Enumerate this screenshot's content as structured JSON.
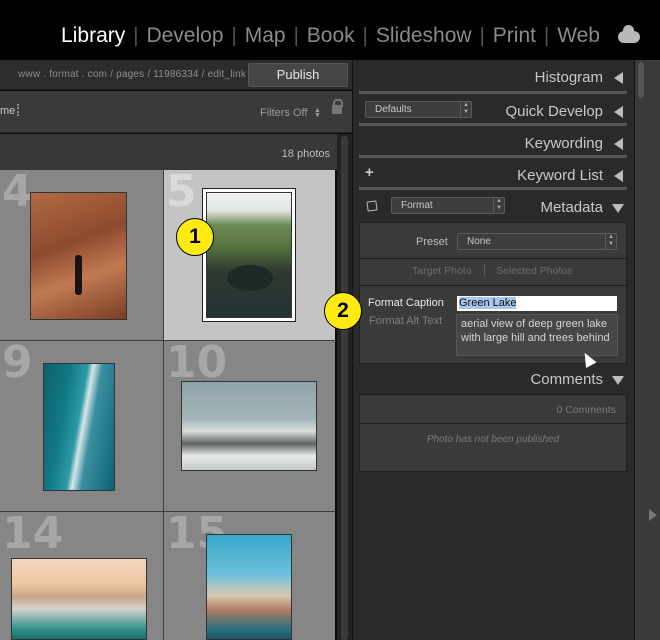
{
  "modules": [
    "Library",
    "Develop",
    "Map",
    "Book",
    "Slideshow",
    "Print",
    "Web"
  ],
  "active_module": "Library",
  "toolbar": {
    "url": "www . format . com / pages / 11986334 / edit_link",
    "publish_label": "Publish",
    "partial_label": "me",
    "filters_label": "Filters Off",
    "photo_count": "18 photos"
  },
  "grid": {
    "cells": [
      "4",
      "5",
      "9",
      "10",
      "14",
      "15"
    ],
    "selected": "5"
  },
  "panel": {
    "histogram": "Histogram",
    "quick_develop": "Quick Develop",
    "quick_develop_preset": "Defaults",
    "keywording": "Keywording",
    "keyword_list": "Keyword List",
    "metadata": "Metadata",
    "metadata_set": "Format",
    "preset_label": "Preset",
    "preset_value": "None",
    "target_photo": "Target Photo",
    "selected_photos": "Selected Photos",
    "format_caption_label": "Format Caption",
    "format_caption_value": "Green Lake",
    "format_alt_label": "Format Alt Text",
    "format_alt_value": "aerial view of deep green lake with large hill and trees behind",
    "comments": "Comments",
    "comments_count": "0 Comments",
    "comments_note": "Photo has not been published"
  },
  "callouts": [
    "1",
    "2"
  ],
  "colors": {
    "callout": "#ffeb12",
    "selected_cell": "#c4c4c4",
    "cell": "#868686",
    "panel": "#2a2a2a"
  }
}
